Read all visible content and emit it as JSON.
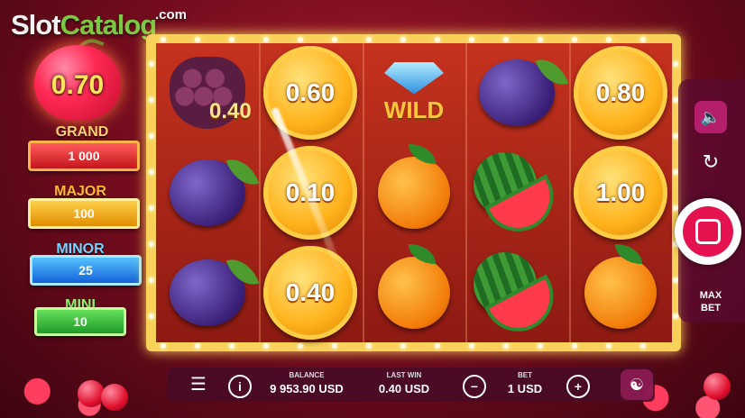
{
  "logo": {
    "part1": "Slot",
    "part2": "Catalog",
    "suffix": ".com"
  },
  "jackpots": {
    "cherry_value": "0.70",
    "grand": {
      "label": "GRAND",
      "value": "1 000"
    },
    "major": {
      "label": "MAJOR",
      "value": "100"
    },
    "minor": {
      "label": "MINOR",
      "value": "25"
    },
    "mini": {
      "label": "MINI",
      "value": "10"
    }
  },
  "reels": {
    "floating_win": "0.40",
    "grid": [
      [
        {
          "symbol": "grapes"
        },
        {
          "symbol": "coin",
          "value": "0.60"
        },
        {
          "symbol": "wild",
          "label": "WILD"
        },
        {
          "symbol": "plum"
        },
        {
          "symbol": "coin",
          "value": "0.80"
        }
      ],
      [
        {
          "symbol": "plum"
        },
        {
          "symbol": "coin",
          "value": "0.10"
        },
        {
          "symbol": "orange"
        },
        {
          "symbol": "watermelon"
        },
        {
          "symbol": "coin",
          "value": "1.00"
        }
      ],
      [
        {
          "symbol": "plum"
        },
        {
          "symbol": "coin",
          "value": "0.40"
        },
        {
          "symbol": "orange"
        },
        {
          "symbol": "watermelon"
        },
        {
          "symbol": "orange"
        }
      ]
    ]
  },
  "side_panel": {
    "max_bet_line1": "MAX",
    "max_bet_line2": "BET"
  },
  "bottom_bar": {
    "balance_label": "BALANCE",
    "balance_value": "9 953.90 USD",
    "last_win_label": "LAST WIN",
    "last_win_value": "0.40 USD",
    "bet_label": "BET",
    "bet_value": "1 USD",
    "minus": "−",
    "plus": "+",
    "info": "i",
    "menu": "☰"
  },
  "colors": {
    "accent_pink": "#e4124f",
    "frame_gold": "#f9d15a"
  }
}
